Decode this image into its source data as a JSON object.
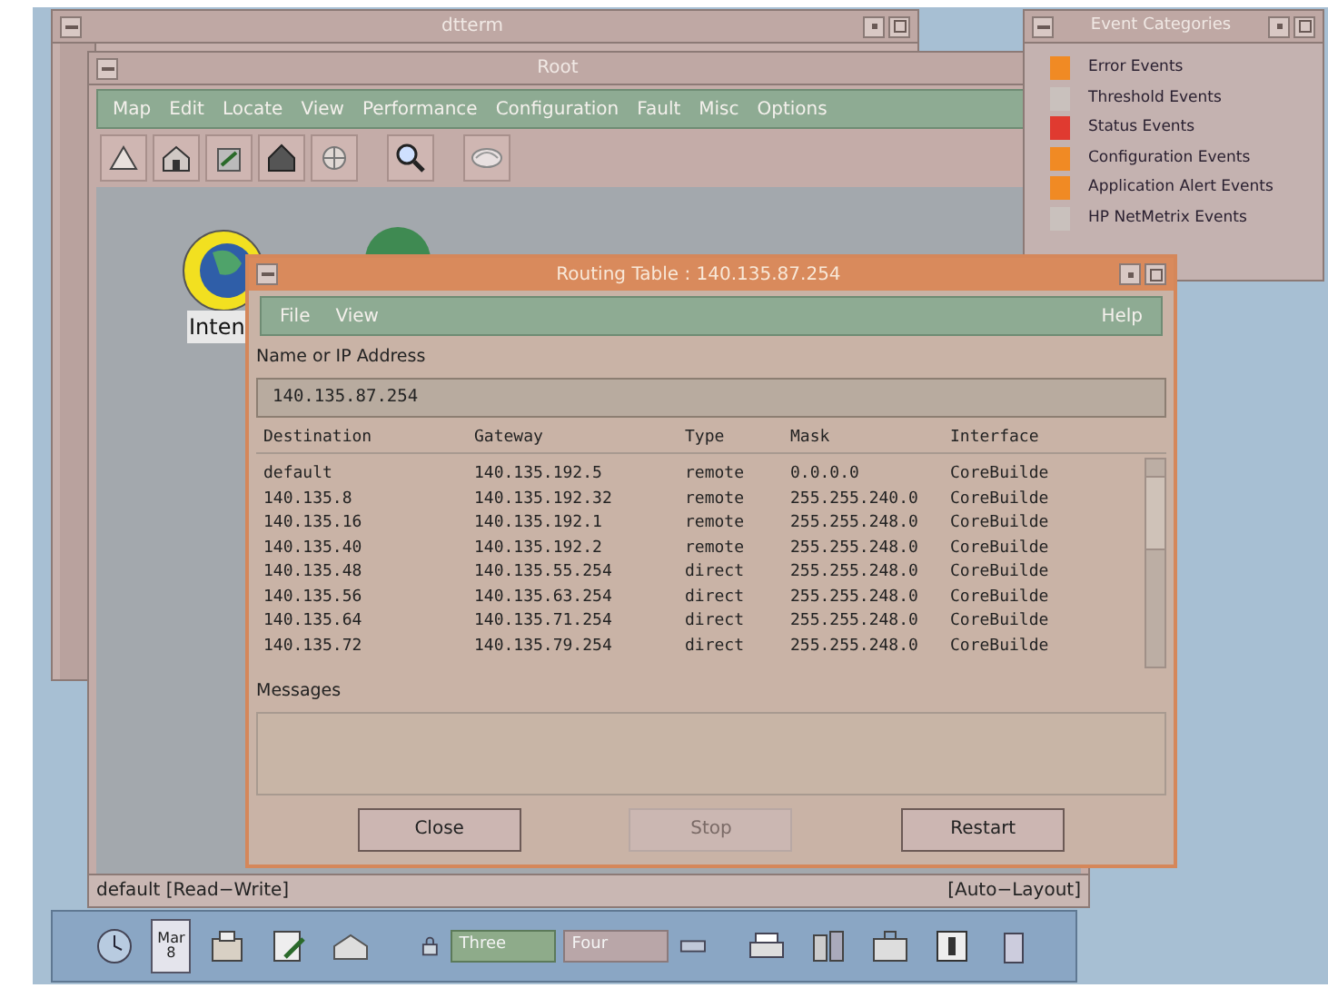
{
  "dtterm": {
    "title": "dtterm"
  },
  "root": {
    "title": "Root",
    "menu": [
      "Map",
      "Edit",
      "Locate",
      "View",
      "Performance",
      "Configuration",
      "Fault",
      "Misc",
      "Options"
    ],
    "map_label": "Inten",
    "status_left": "default [Read−Write]",
    "status_right": "[Auto−Layout]"
  },
  "event_categories": {
    "title": "Event Categories",
    "items": [
      {
        "label": "Error Events",
        "color": "#f08a24"
      },
      {
        "label": "Threshold Events",
        "color": "#c9c1bd"
      },
      {
        "label": "Status Events",
        "color": "#e03a30"
      },
      {
        "label": "Configuration Events",
        "color": "#f08a24"
      },
      {
        "label": "Application Alert Events",
        "color": "#f08a24"
      },
      {
        "label": "HP NetMetrix Events",
        "color": "#c9c1bd"
      }
    ]
  },
  "routing_table": {
    "title": "Routing Table : 140.135.87.254",
    "menu": [
      "File",
      "View"
    ],
    "help": "Help",
    "field_label": "Name or IP Address",
    "field_value": "140.135.87.254",
    "columns": [
      "Destination",
      "Gateway",
      "Type",
      "Mask",
      "Interface"
    ],
    "rows": [
      [
        "default",
        "140.135.192.5",
        "remote",
        "0.0.0.0",
        "CoreBuilde"
      ],
      [
        "140.135.8",
        "140.135.192.32",
        "remote",
        "255.255.240.0",
        "CoreBuilde"
      ],
      [
        "140.135.16",
        "140.135.192.1",
        "remote",
        "255.255.248.0",
        "CoreBuilde"
      ],
      [
        "140.135.40",
        "140.135.192.2",
        "remote",
        "255.255.248.0",
        "CoreBuilde"
      ],
      [
        "140.135.48",
        "140.135.55.254",
        "direct",
        "255.255.248.0",
        "CoreBuilde"
      ],
      [
        "140.135.56",
        "140.135.63.254",
        "direct",
        "255.255.248.0",
        "CoreBuilde"
      ],
      [
        "140.135.64",
        "140.135.71.254",
        "direct",
        "255.255.248.0",
        "CoreBuilde"
      ],
      [
        "140.135.72",
        "140.135.79.254",
        "direct",
        "255.255.248.0",
        "CoreBuilde"
      ]
    ],
    "messages_label": "Messages",
    "buttons": [
      {
        "label": "Close",
        "disabled": false
      },
      {
        "label": "Stop",
        "disabled": true
      },
      {
        "label": "Restart",
        "disabled": false
      }
    ]
  },
  "front_panel": {
    "calendar": {
      "month": "Mar",
      "day": "8"
    },
    "workspaces": [
      {
        "label": "Three",
        "selected": true
      },
      {
        "label": "Four",
        "selected": false
      }
    ]
  }
}
